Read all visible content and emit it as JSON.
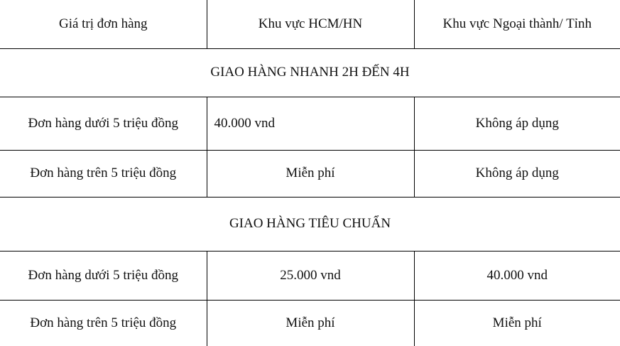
{
  "table": {
    "header": [
      "Giá trị đơn hàng",
      "Khu vực HCM/HN",
      "Khu vực Ngoại thành/ Tỉnh"
    ],
    "sections": [
      {
        "title": "GIAO HÀNG NHANH 2H ĐẾN 4H",
        "rows": [
          [
            "Đơn hàng dưới 5 triệu đồng",
            "40.000 vnd",
            "Không áp dụng"
          ],
          [
            "Đơn hàng trên 5 triệu đồng",
            "Miễn phí",
            "Không áp dụng"
          ]
        ]
      },
      {
        "title": "GIAO HÀNG TIÊU CHUẨN",
        "rows": [
          [
            "Đơn hàng dưới 5 triệu đồng",
            "25.000 vnd",
            "40.000 vnd"
          ],
          [
            "Đơn hàng trên 5 triệu đồng",
            "Miễn phí",
            "Miễn phí"
          ]
        ]
      }
    ]
  }
}
